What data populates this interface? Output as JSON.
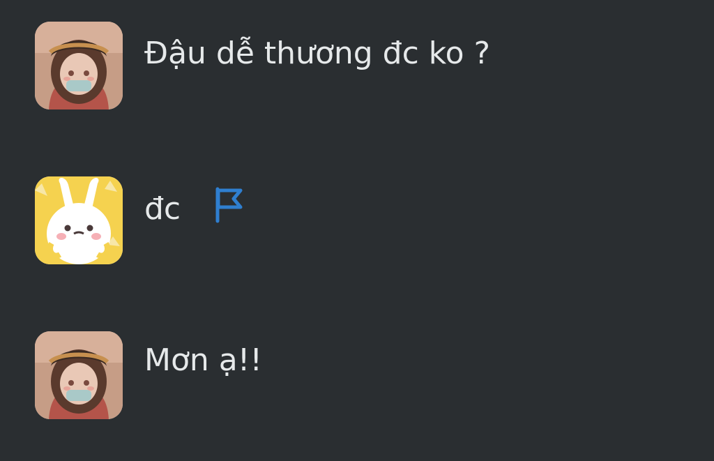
{
  "messages": [
    {
      "text": "Đậu dễ thương đc ko ?",
      "avatar": "girl-avatar-icon"
    },
    {
      "text": "đc",
      "avatar": "crying-bunny-avatar-icon",
      "action_icon": "flag-icon"
    },
    {
      "text": "Mơn ạ!!",
      "avatar": "girl-avatar-icon"
    }
  ],
  "colors": {
    "background": "#2a2e31",
    "text": "#e6e9ea",
    "flag": "#2f7fd0"
  }
}
